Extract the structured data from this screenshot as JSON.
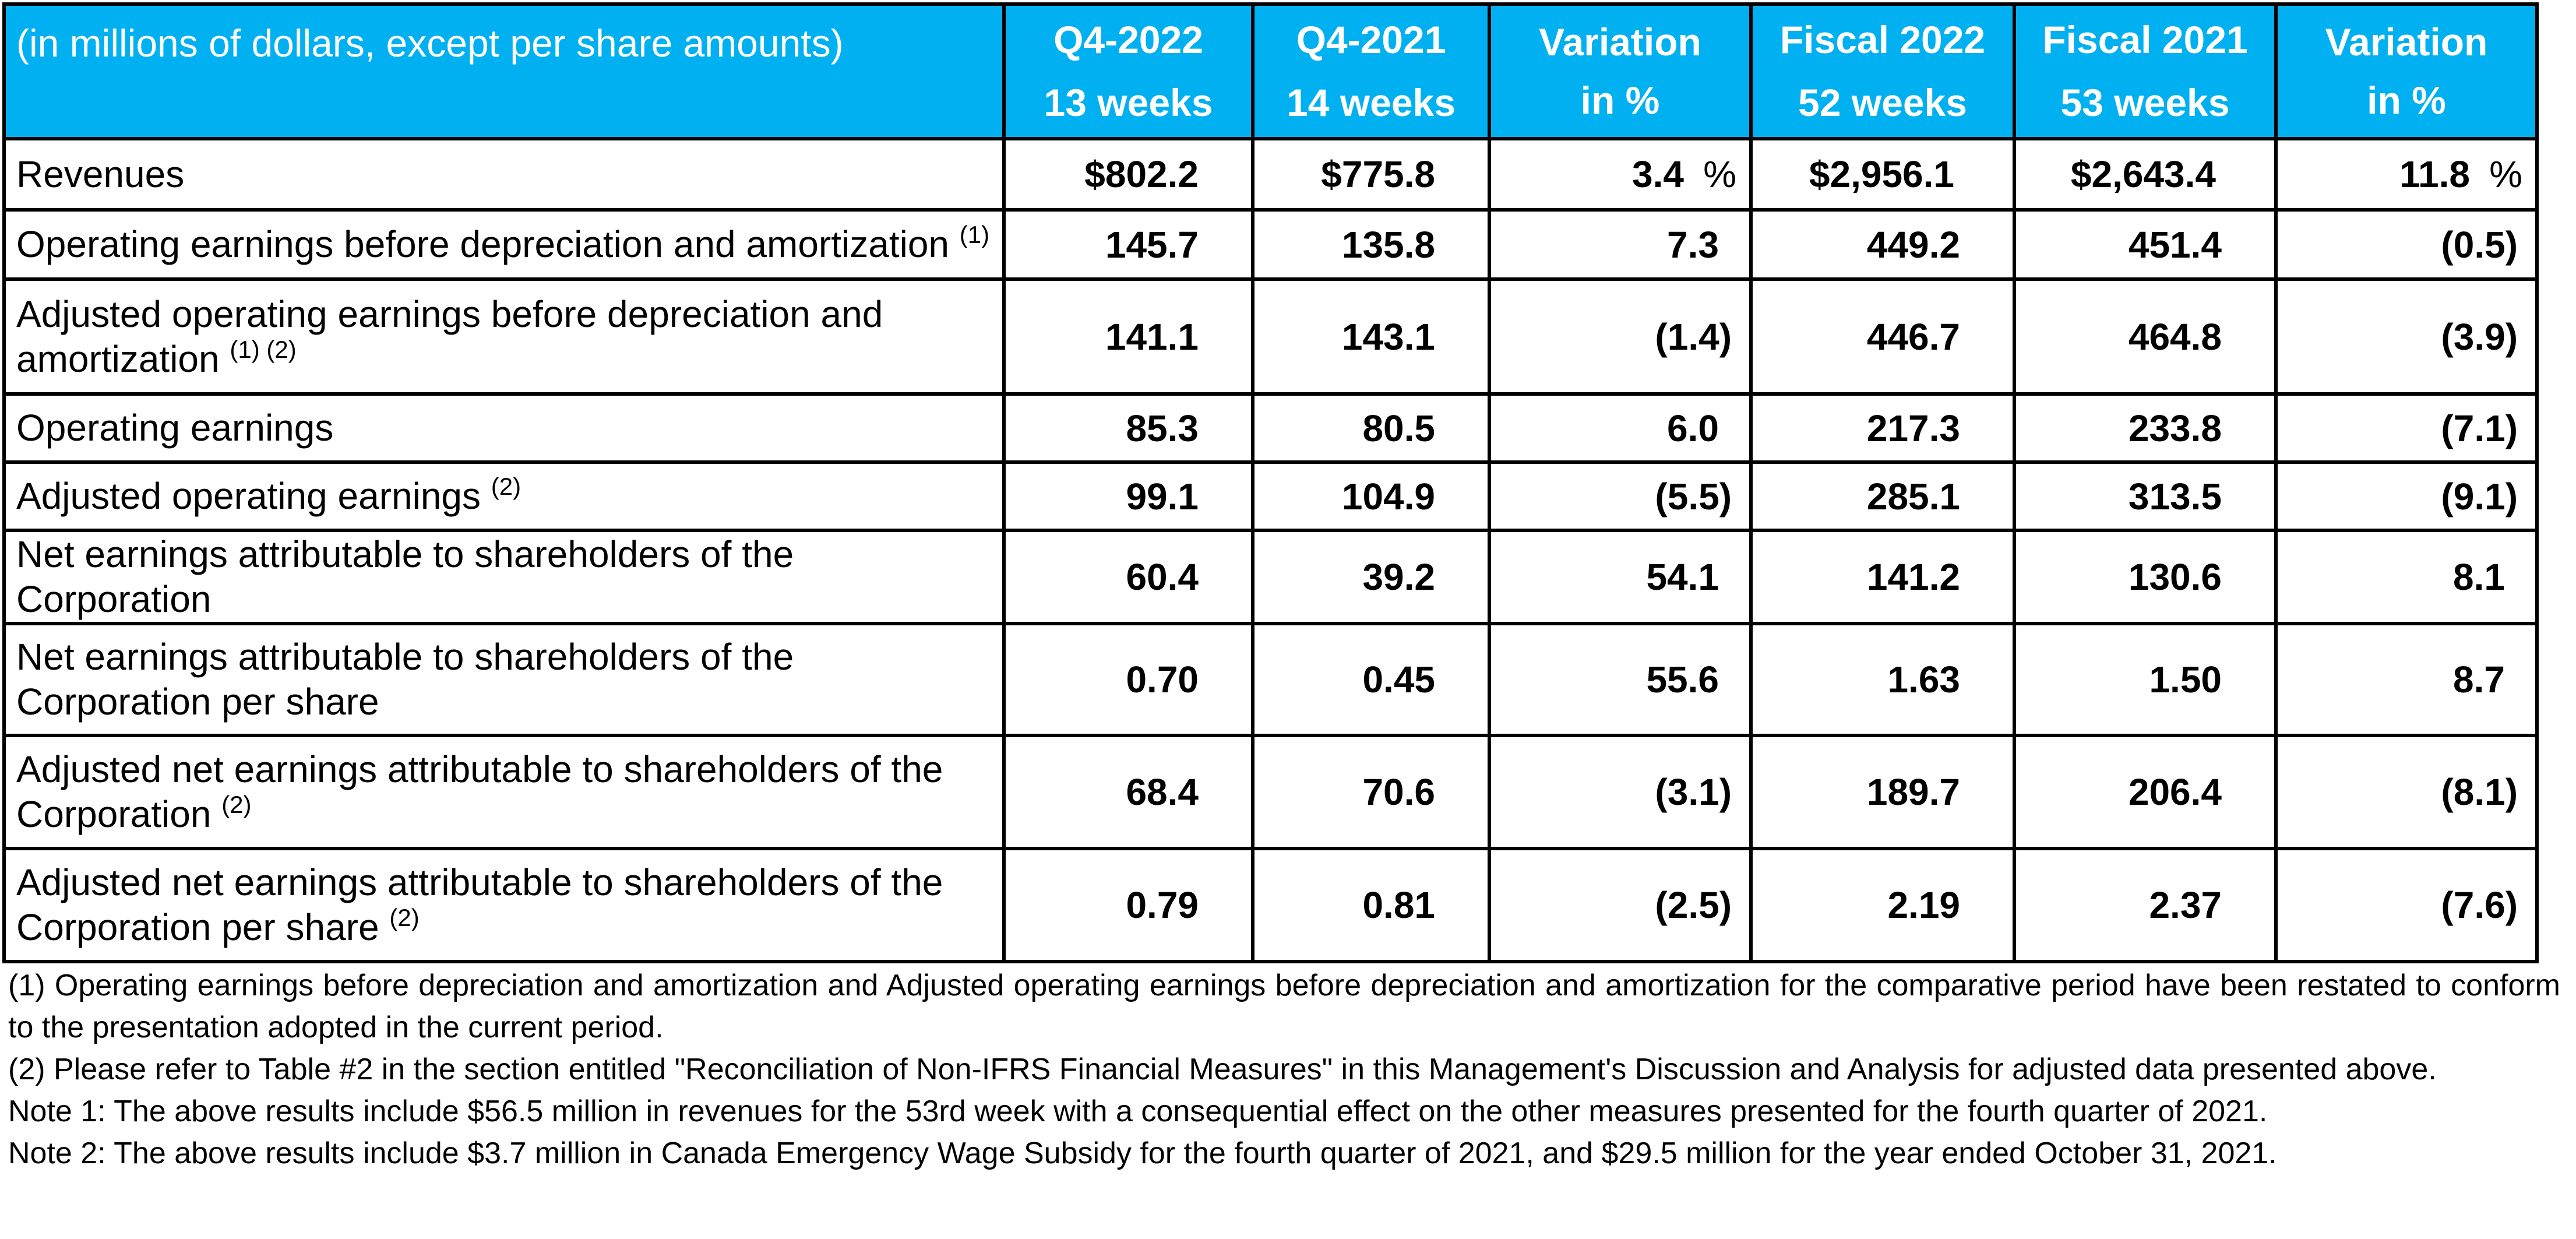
{
  "table": {
    "header": {
      "unit_note": "(in millions of dollars, except per share amounts)",
      "columns": [
        {
          "title": "Q4-2022",
          "sub": "13 weeks"
        },
        {
          "title": "Q4-2021",
          "sub": "14 weeks"
        },
        {
          "title": "Variation",
          "sub": "in %"
        },
        {
          "title": "Fiscal 2022",
          "sub": "52 weeks"
        },
        {
          "title": "Fiscal 2021",
          "sub": "53 weeks"
        },
        {
          "title": "Variation",
          "sub": "in %"
        }
      ]
    },
    "rows": [
      {
        "label": "Revenues",
        "notes": "",
        "values": [
          "$802.2",
          "$775.8",
          "3.4",
          "$2,956.1",
          "$2,643.4",
          "11.8"
        ],
        "pct_sign": "%"
      },
      {
        "label": "Operating earnings before depreciation and amortization",
        "notes": "(1)",
        "values": [
          "145.7",
          "135.8",
          "7.3",
          "449.2",
          "451.4",
          "(0.5)"
        ]
      },
      {
        "label": "Adjusted operating earnings before depreciation and amortization",
        "notes": "(1) (2)",
        "values": [
          "141.1",
          "143.1",
          "(1.4)",
          "446.7",
          "464.8",
          "(3.9)"
        ]
      },
      {
        "label": "Operating earnings",
        "notes": "",
        "values": [
          "85.3",
          "80.5",
          "6.0",
          "217.3",
          "233.8",
          "(7.1)"
        ]
      },
      {
        "label": "Adjusted operating earnings",
        "notes": "(2)",
        "values": [
          "99.1",
          "104.9",
          "(5.5)",
          "285.1",
          "313.5",
          "(9.1)"
        ]
      },
      {
        "label": "Net earnings attributable to shareholders of the Corporation",
        "notes": "",
        "values": [
          "60.4",
          "39.2",
          "54.1",
          "141.2",
          "130.6",
          "8.1"
        ]
      },
      {
        "label": "Net earnings attributable to shareholders of the Corporation per share",
        "notes": "",
        "values": [
          "0.70",
          "0.45",
          "55.6",
          "1.63",
          "1.50",
          "8.7"
        ]
      },
      {
        "label": "Adjusted net earnings attributable to shareholders of the Corporation",
        "notes": "(2)",
        "values": [
          "68.4",
          "70.6",
          "(3.1)",
          "189.7",
          "206.4",
          "(8.1)"
        ]
      },
      {
        "label": "Adjusted net earnings attributable to shareholders of the Corporation per share",
        "notes": "(2)",
        "values": [
          "0.79",
          "0.81",
          "(2.5)",
          "2.19",
          "2.37",
          "(7.6)"
        ]
      }
    ]
  },
  "footnotes": [
    "(1) Operating earnings before depreciation and amortization and Adjusted operating earnings before depreciation and amortization for the comparative period have been restated to conform to the presentation adopted in the current period.",
    "(2)  Please refer to Table #2 in the section entitled \"Reconciliation of Non-IFRS Financial Measures\" in this Management's Discussion and Analysis for adjusted data presented above.",
    "Note 1: The above results include $56.5 million in revenues for the 53rd week with a consequential effect on the other measures presented for the fourth quarter of 2021.",
    "Note 2: The above results include $3.7 million in Canada Emergency Wage Subsidy for the fourth quarter of 2021, and $29.5 million for the year ended October 31, 2021."
  ],
  "colors": {
    "header_bg": "#00B0F0",
    "header_text": "#FFFFFF",
    "border": "#000000"
  }
}
